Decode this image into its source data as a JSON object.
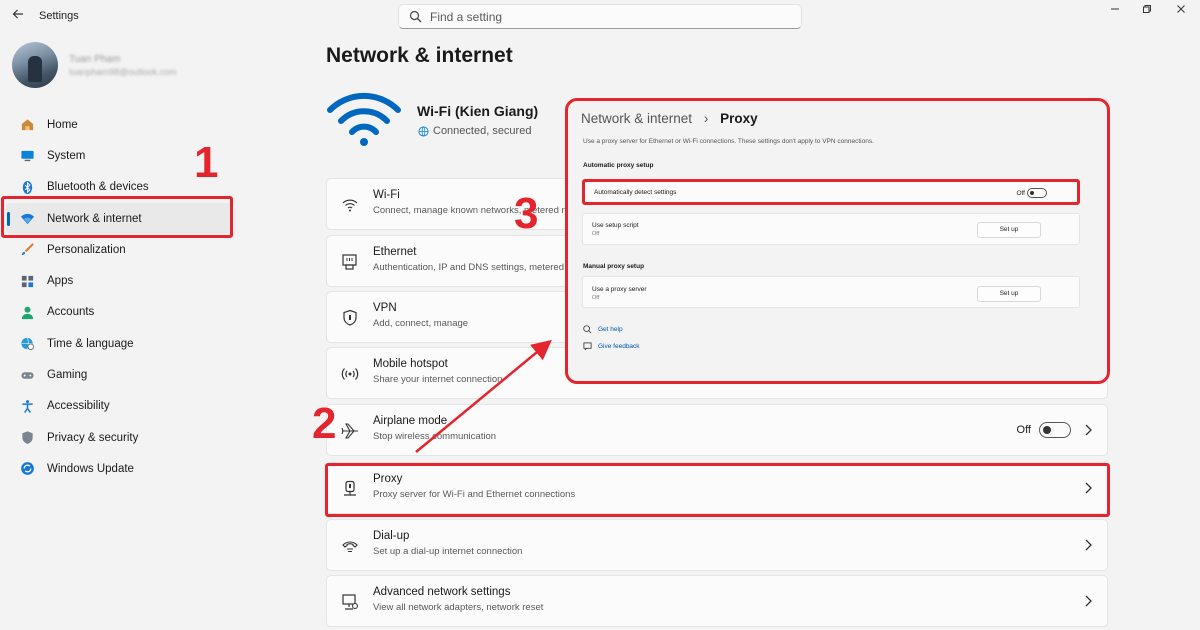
{
  "window": {
    "title": "Settings",
    "back_icon": "arrow-left-icon",
    "controls": [
      "minimize-icon",
      "maximize-icon",
      "close-icon"
    ]
  },
  "search": {
    "placeholder": "Find a setting"
  },
  "profile": {
    "name": "Tuan Pham",
    "email": "tuanpham98@outlook.com"
  },
  "sidebar": {
    "items": [
      {
        "label": "Home",
        "icon": "home-icon",
        "active": false
      },
      {
        "label": "System",
        "icon": "display-icon",
        "active": false
      },
      {
        "label": "Bluetooth & devices",
        "icon": "bluetooth-icon",
        "active": false
      },
      {
        "label": "Network & internet",
        "icon": "wifi-icon",
        "active": true
      },
      {
        "label": "Personalization",
        "icon": "brush-icon",
        "active": false
      },
      {
        "label": "Apps",
        "icon": "apps-icon",
        "active": false
      },
      {
        "label": "Accounts",
        "icon": "person-icon",
        "active": false
      },
      {
        "label": "Time & language",
        "icon": "globe-clock-icon",
        "active": false
      },
      {
        "label": "Gaming",
        "icon": "gamepad-icon",
        "active": false
      },
      {
        "label": "Accessibility",
        "icon": "accessibility-icon",
        "active": false
      },
      {
        "label": "Privacy & security",
        "icon": "shield-icon",
        "active": false
      },
      {
        "label": "Windows Update",
        "icon": "update-icon",
        "active": false
      }
    ]
  },
  "main": {
    "title": "Network & internet",
    "connection": {
      "name": "Wi-Fi (Kien Giang)",
      "status": "Connected, secured"
    },
    "cards": [
      {
        "title": "Wi-Fi",
        "subtitle": "Connect, manage known networks, metered network",
        "icon": "wifi-icon"
      },
      {
        "title": "Ethernet",
        "subtitle": "Authentication, IP and DNS settings, metered network",
        "icon": "ethernet-icon"
      },
      {
        "title": "VPN",
        "subtitle": "Add, connect, manage",
        "icon": "vpn-shield-icon"
      },
      {
        "title": "Mobile hotspot",
        "subtitle": "Share your internet connection",
        "icon": "hotspot-icon"
      },
      {
        "title": "Airplane mode",
        "subtitle": "Stop wireless communication",
        "icon": "airplane-icon",
        "toggle": "Off"
      },
      {
        "title": "Proxy",
        "subtitle": "Proxy server for Wi-Fi and Ethernet connections",
        "icon": "proxy-icon"
      },
      {
        "title": "Dial-up",
        "subtitle": "Set up a dial-up internet connection",
        "icon": "dialup-icon"
      },
      {
        "title": "Advanced network settings",
        "subtitle": "View all network adapters, network reset",
        "icon": "network-adapter-icon"
      }
    ]
  },
  "proxy_panel": {
    "breadcrumb_parent": "Network & internet",
    "breadcrumb_separator": "›",
    "breadcrumb_current": "Proxy",
    "description": "Use a proxy server for Ethernet or Wi-Fi connections. These settings don't apply to VPN connections.",
    "auto_heading": "Automatic proxy setup",
    "auto_detect": {
      "label": "Automatically detect settings",
      "state": "Off"
    },
    "setup_script": {
      "label": "Use setup script",
      "state": "Off",
      "button": "Set up"
    },
    "manual_heading": "Manual proxy setup",
    "proxy_server": {
      "label": "Use a proxy server",
      "state": "Off",
      "button": "Set up"
    },
    "links": {
      "help": "Get help",
      "feedback": "Give feedback"
    }
  },
  "annotations": {
    "step1": "1",
    "step2": "2",
    "step3": "3",
    "color": "#e5252e"
  }
}
